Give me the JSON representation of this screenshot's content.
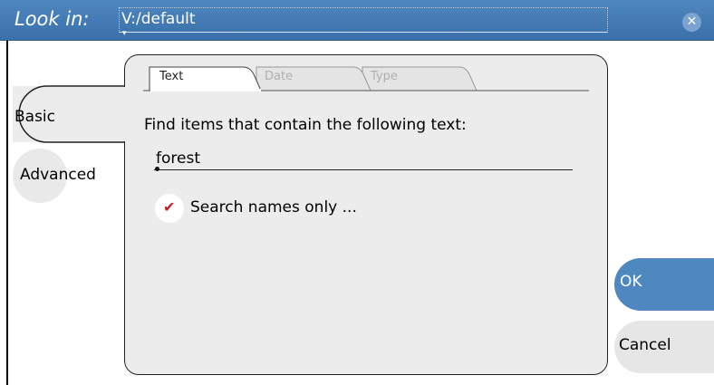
{
  "titlebar": {
    "look_in_label": "Look in:",
    "path": "V:/default",
    "close_glyph": "✕"
  },
  "side_tabs": {
    "basic_label": "Basic",
    "advanced_label": "Advanced",
    "selected": "Basic"
  },
  "tabs": {
    "text_label": "Text",
    "date_label": "Date",
    "type_label": "Type",
    "selected": "Text"
  },
  "main": {
    "find_label": "Find items that contain the following text:",
    "search_value": "forest",
    "names_only_label": "Search names only ...",
    "names_only_checked": true,
    "check_glyph": "✔"
  },
  "buttons": {
    "ok_label": "OK",
    "cancel_label": "Cancel"
  },
  "colors": {
    "titlebar": "#4f87bf",
    "ok_button": "#4f87bf",
    "panel": "#ececec",
    "check": "#c42020"
  }
}
